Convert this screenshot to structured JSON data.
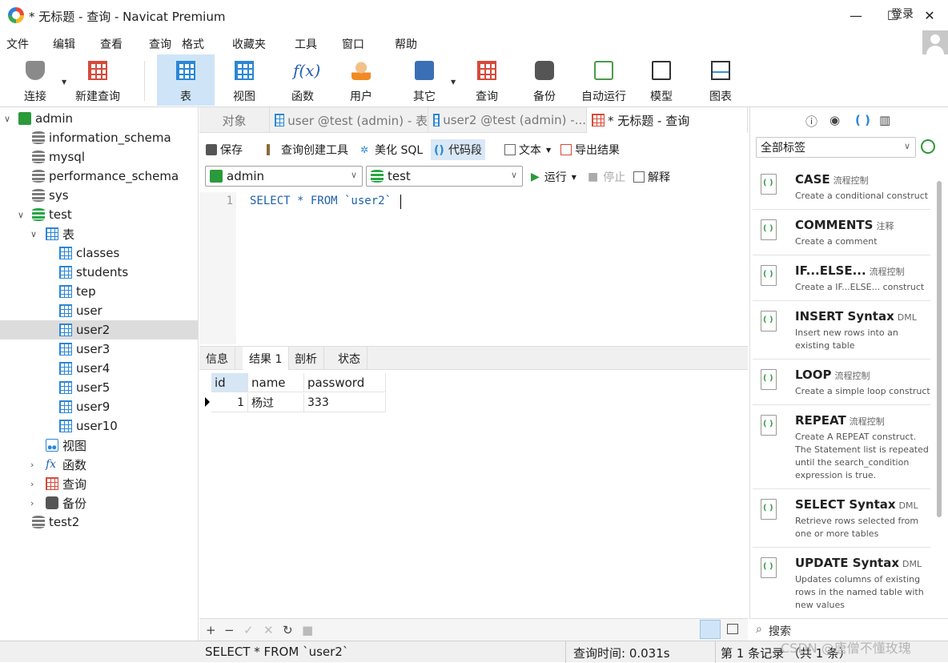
{
  "window": {
    "title": "* 无标题 - 查询 - Navicat Premium",
    "min": "—",
    "max": "☐",
    "close": "✕"
  },
  "menu": {
    "items": [
      "文件",
      "编辑",
      "查看",
      "查询",
      "格式",
      "收藏夹",
      "工具",
      "窗口",
      "帮助"
    ],
    "login": "登录"
  },
  "toolbar": {
    "items": [
      "连接",
      "新建查询",
      "表",
      "视图",
      "函数",
      "用户",
      "其它",
      "查询",
      "备份",
      "自动运行",
      "模型",
      "图表"
    ],
    "active": "表"
  },
  "sidebar": {
    "connection": "admin",
    "databases": [
      "information_schema",
      "mysql",
      "performance_schema",
      "sys",
      "test"
    ],
    "test_children": {
      "tables_label": "表",
      "tables": [
        "classes",
        "students",
        "tep",
        "user",
        "user2",
        "user3",
        "user4",
        "user5",
        "user9",
        "user10"
      ],
      "selected": "user2",
      "views": "视图",
      "functions": "函数",
      "queries": "查询",
      "backups": "备份"
    },
    "other_db": "test2"
  },
  "tabs": {
    "objects": "对象",
    "t1": "user @test (admin) - 表",
    "t2": "user2 @test (admin) -...",
    "t3": "* 无标题 - 查询"
  },
  "query_toolbar": {
    "save": "保存",
    "builder": "查询创建工具",
    "beautify": "美化 SQL",
    "snippet": "代码段",
    "text": "文本",
    "export": "导出结果"
  },
  "selectors": {
    "connection": "admin",
    "database": "test",
    "run": "运行",
    "stop": "停止",
    "explain": "解释"
  },
  "editor": {
    "line": "1",
    "sql": "SELECT * FROM `user2`"
  },
  "result_tabs": [
    "信息",
    "结果 1",
    "剖析",
    "状态"
  ],
  "result": {
    "columns": [
      "id",
      "name",
      "password"
    ],
    "rows": [
      [
        "1",
        "杨过",
        "333"
      ]
    ]
  },
  "grid_footer": {
    "add": "+",
    "remove": "−",
    "apply": "✓",
    "discard": "✕",
    "refresh": "↻",
    "stop": "■"
  },
  "right_panel": {
    "filter": "全部标签",
    "snippets": [
      {
        "name": "CASE",
        "tag": "流程控制",
        "desc": "Create a conditional construct"
      },
      {
        "name": "COMMENTS",
        "tag": "注释",
        "desc": "Create a comment"
      },
      {
        "name": "IF...ELSE...",
        "tag": "流程控制",
        "desc": "Create a IF...ELSE... construct"
      },
      {
        "name": "INSERT Syntax",
        "tag": "DML",
        "desc": "Insert new rows into an existing table"
      },
      {
        "name": "LOOP",
        "tag": "流程控制",
        "desc": "Create a simple loop construct"
      },
      {
        "name": "REPEAT",
        "tag": "流程控制",
        "desc": "Create A REPEAT construct. The Statement list is repeated until the search_condition expression is true."
      },
      {
        "name": "SELECT Syntax",
        "tag": "DML",
        "desc": "Retrieve rows selected from one or more tables"
      },
      {
        "name": "UPDATE Syntax",
        "tag": "DML",
        "desc": "Updates columns of existing rows in the named table with new values"
      }
    ],
    "search": "搜索"
  },
  "status": {
    "sql": "SELECT * FROM `user2`",
    "time": "查询时间: 0.031s",
    "records": "第 1 条记录 （共 1 条）"
  },
  "watermark": "CSDN @唐僧不懂玫瑰"
}
